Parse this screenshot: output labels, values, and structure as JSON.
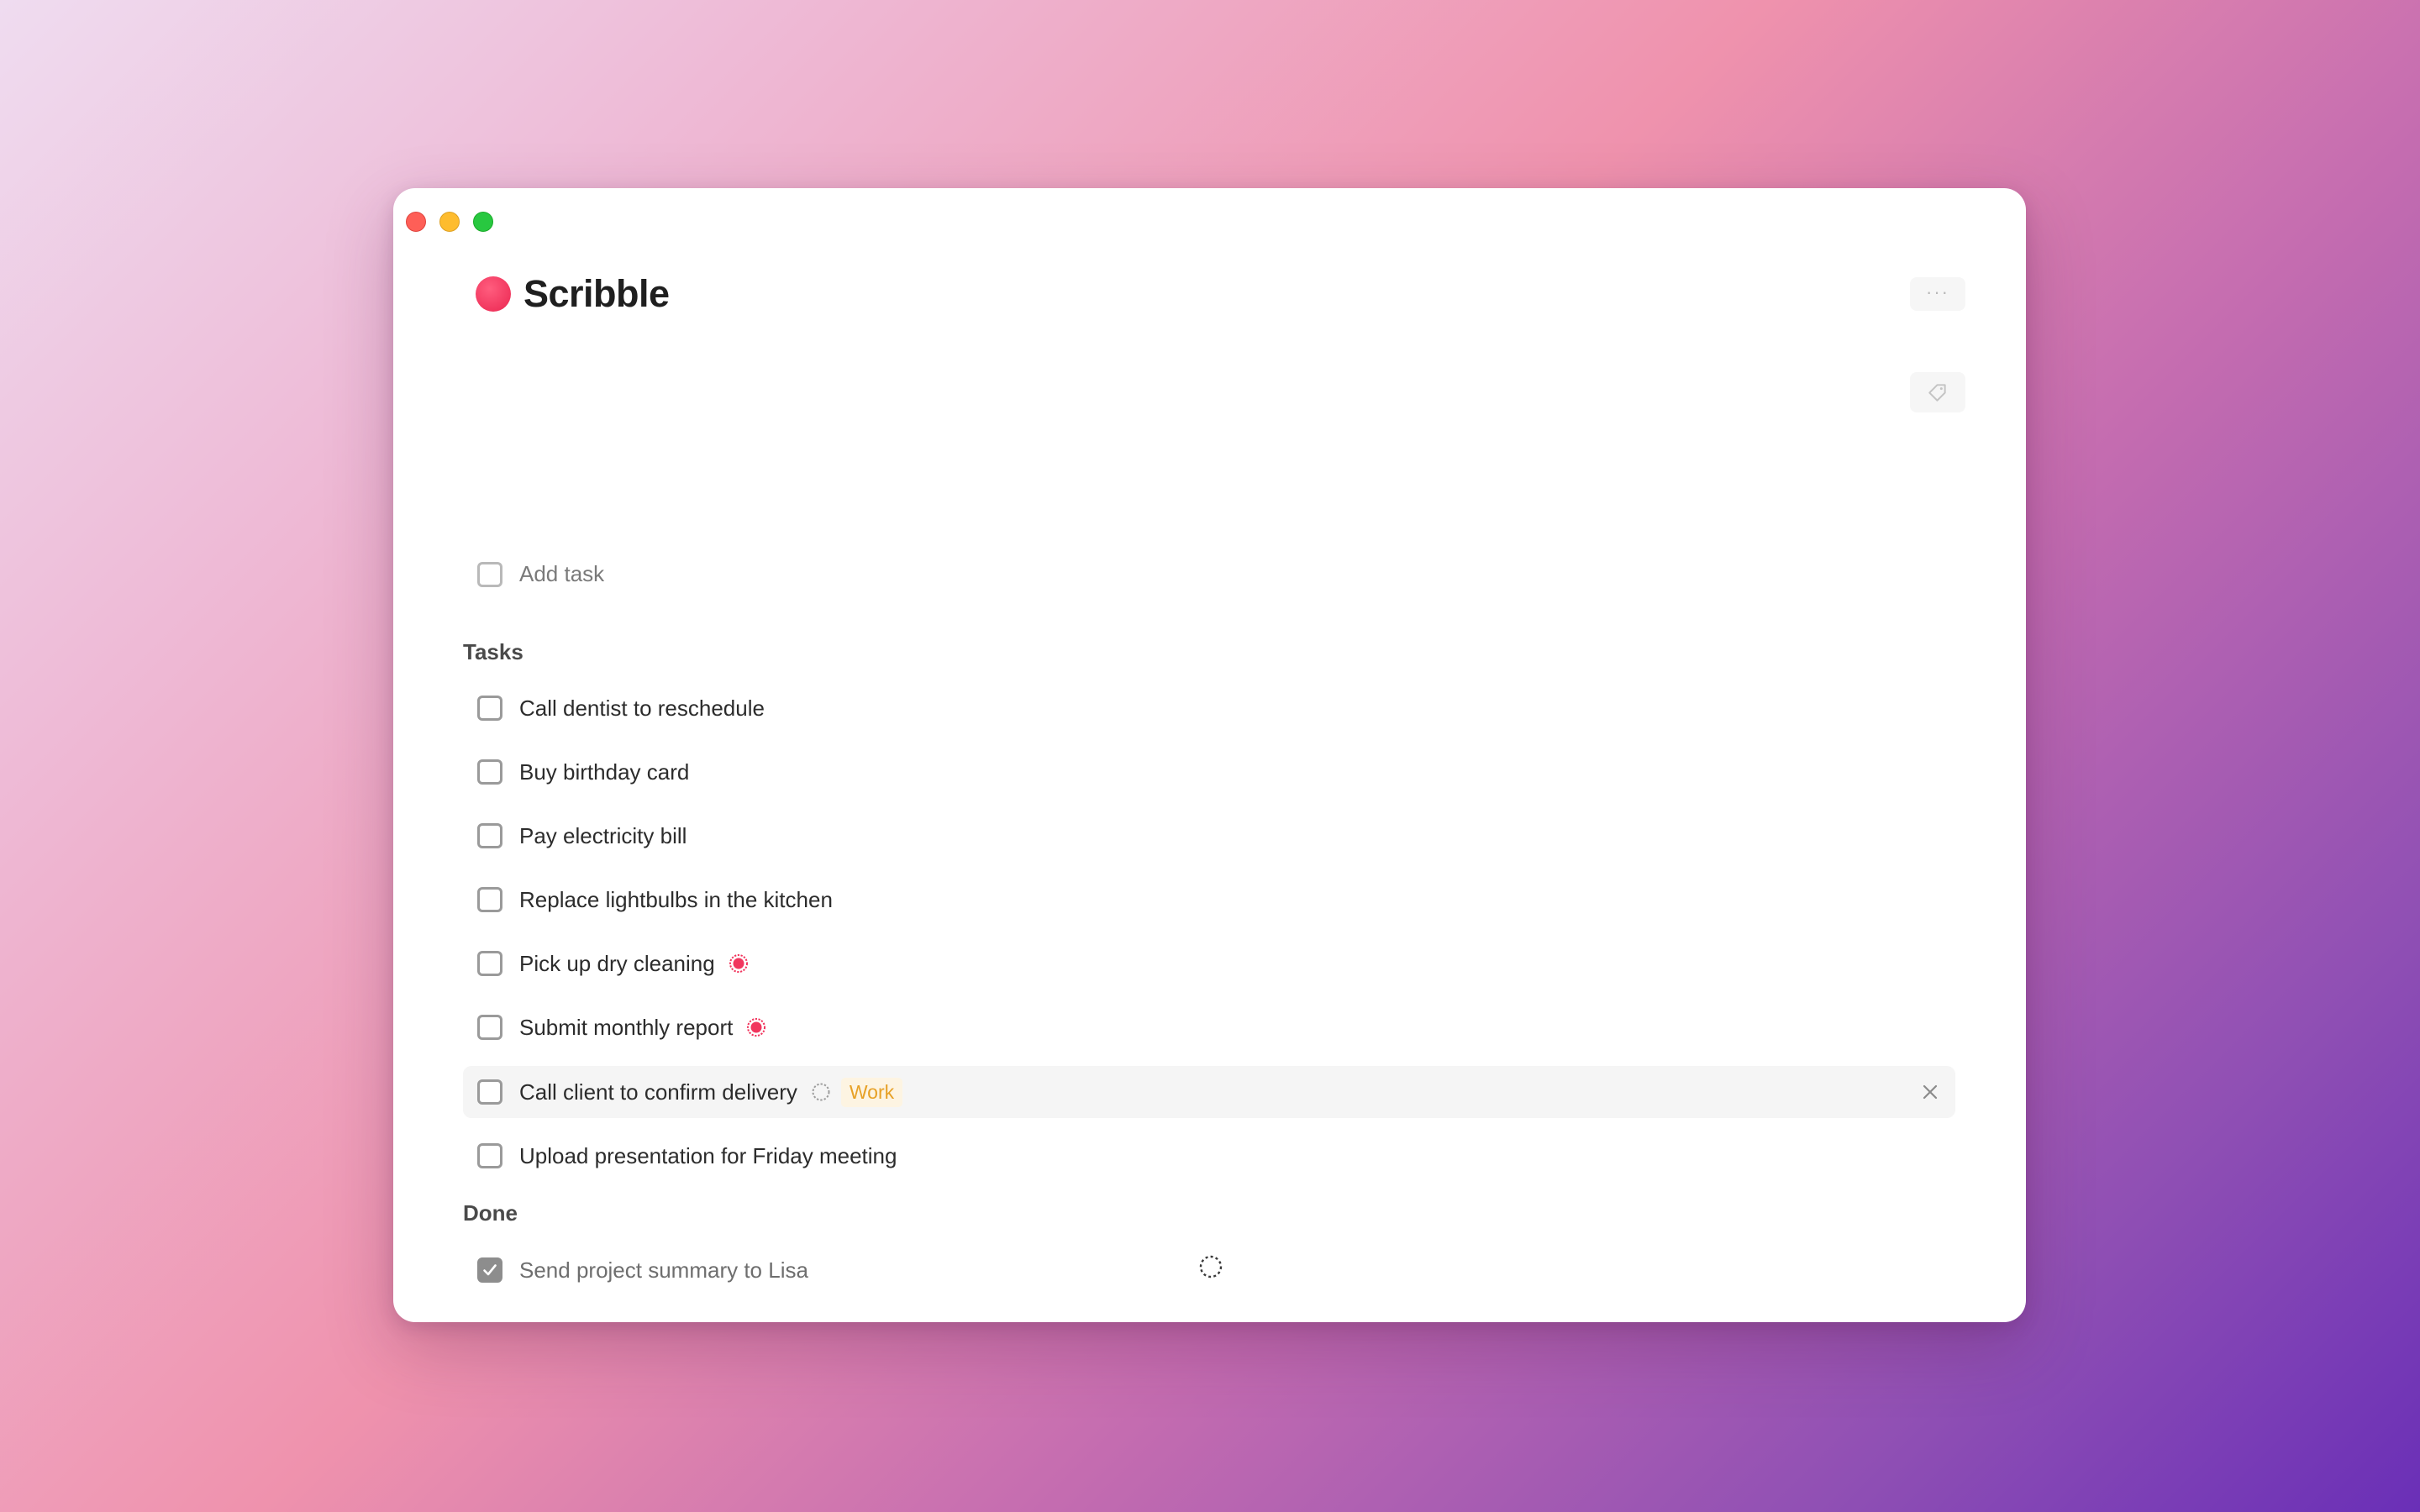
{
  "window": {
    "app_name": "Scribble",
    "more_label": "···"
  },
  "add_task": {
    "placeholder": "Add task"
  },
  "sections": {
    "tasks_title": "Tasks",
    "done_title": "Done"
  },
  "tasks": [
    {
      "label": "Call dentist to reschedule",
      "checked": false
    },
    {
      "label": "Buy birthday card",
      "checked": false
    },
    {
      "label": "Pay electricity bill",
      "checked": false
    },
    {
      "label": "Replace lightbulbs in the kitchen",
      "checked": false
    },
    {
      "label": "Pick up dry cleaning",
      "checked": false,
      "icon": "flag-icon"
    },
    {
      "label": "Submit monthly report",
      "checked": false,
      "icon": "flag-icon"
    },
    {
      "label": "Call client to confirm delivery",
      "checked": false,
      "icon": "repeat-icon",
      "tag": "Work"
    },
    {
      "label": "Upload presentation for Friday meeting",
      "checked": false
    }
  ],
  "done": [
    {
      "label": "Send project summary to Lisa",
      "checked": true
    }
  ],
  "colors": {
    "accent": "#f1365e",
    "tag_text": "#e7a126",
    "tag_bg": "#fdf4e2"
  }
}
